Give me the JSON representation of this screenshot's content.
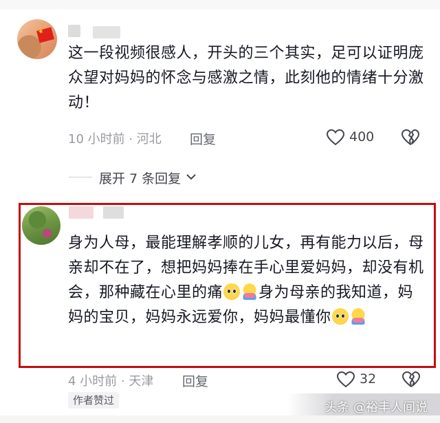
{
  "comments": [
    {
      "text": "这一段视频很感人，开头的三个其实，足可以证明庞众望对妈妈的怀念与感激之情，此刻他的情绪十分激动！",
      "meta": "10 小时前 · 河北",
      "reply_label": "回复",
      "likes": "400"
    },
    {
      "text_parts": [
        "身为人母，最能理解孝顺的儿女，再有能力以后，母亲却不在了，想把妈妈捧在手心里爱妈妈，却没有机会，那种藏在心里的痛",
        "身为母亲的我知道，妈妈的宝贝，妈妈永远爱你，妈妈最懂你"
      ],
      "meta": "4 小时前 · 天津",
      "reply_label": "回复",
      "likes": "32",
      "badge": "作者赞过"
    }
  ],
  "expand_replies": "展开 7 条回复",
  "watermark": "头条 @裕丰人间说",
  "colors": {
    "highlight_border": "#c40d0d",
    "text": "#161823",
    "meta": "#999aa0"
  },
  "icons": {
    "like": "heart-outline-icon",
    "dislike": "broken-heart-icon",
    "expand": "chevron-down-icon",
    "emoji_1": "pleading-face-emoji",
    "emoji_2": "hugging-face-emoji"
  }
}
